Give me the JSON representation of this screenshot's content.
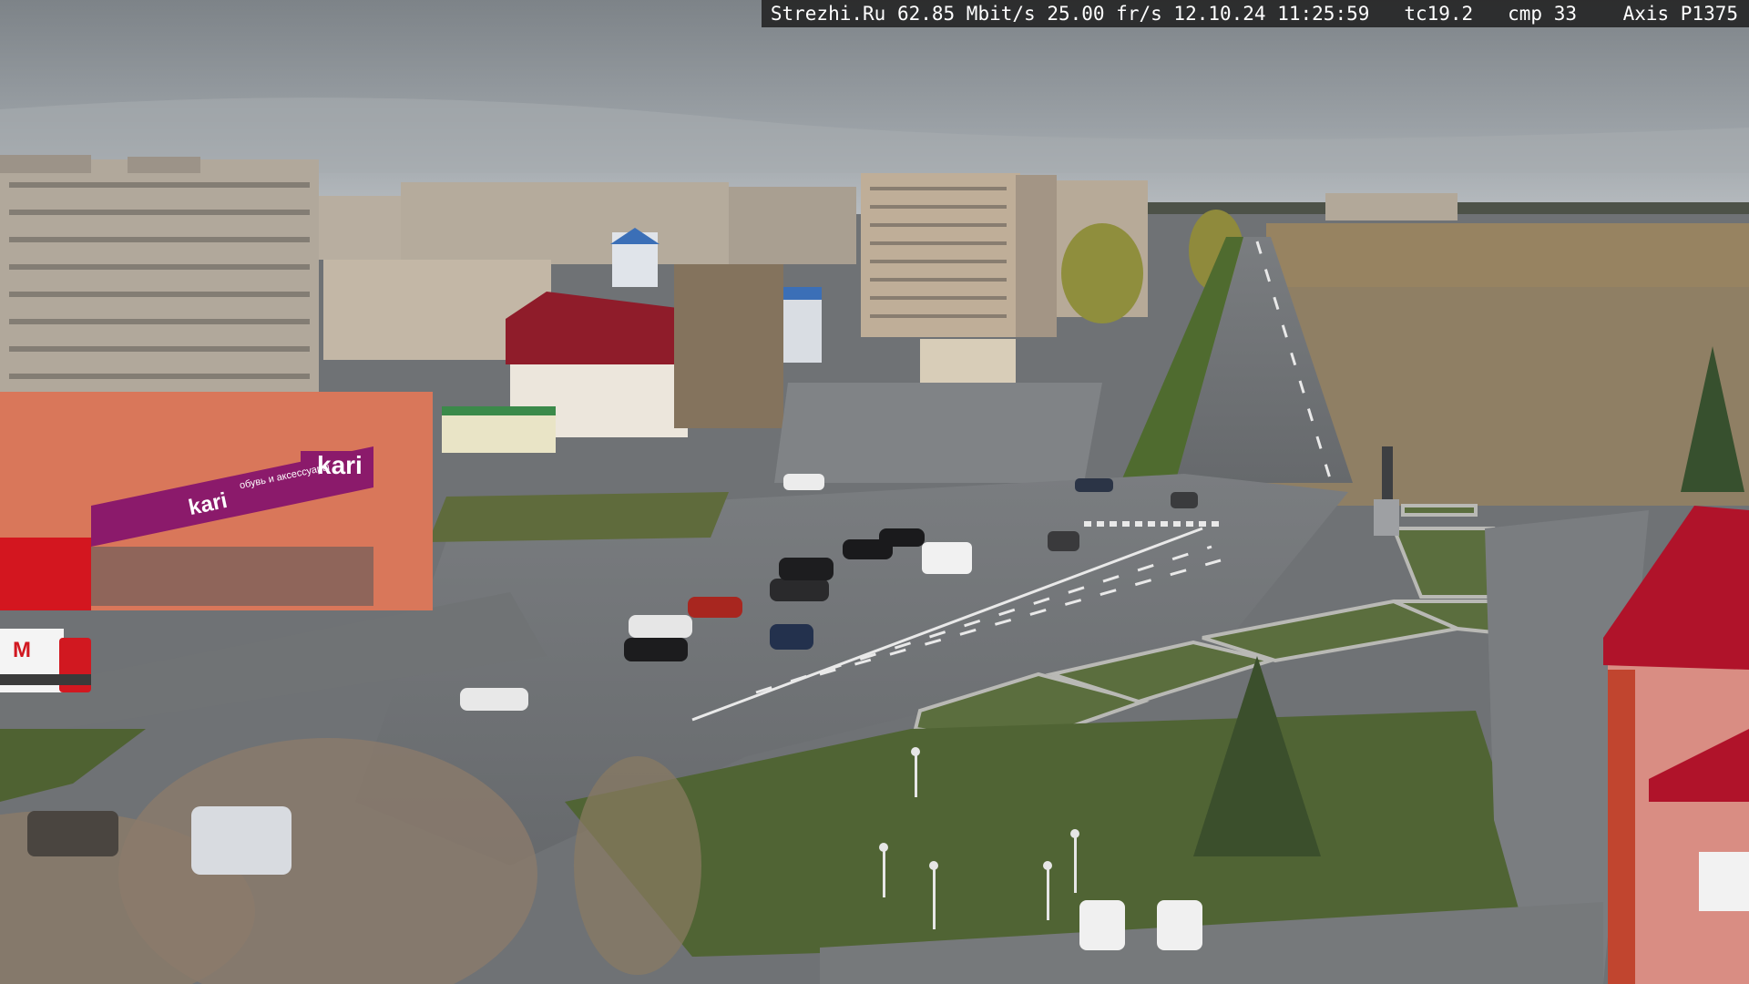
{
  "overlay": {
    "site": "Strezhi.Ru",
    "bitrate": "62.85 Mbit/s",
    "framerate": "25.00 fr/s",
    "date": "12.10.24",
    "time": "11:25:59",
    "tc": "tc19.2",
    "cmp": "cmp 33",
    "camera": "Axis P1375"
  },
  "signs": {
    "store_brand": "kari",
    "store_brand_small": "kari",
    "store_slogan": "обувь и аксессуары",
    "truck_logo": "M"
  },
  "colors": {
    "sky": "#9aa0a5",
    "asphalt": "#6d7073",
    "grass": "#556b3a",
    "store_sign": "#8b1a6b",
    "roof_red": "#b0132a"
  }
}
